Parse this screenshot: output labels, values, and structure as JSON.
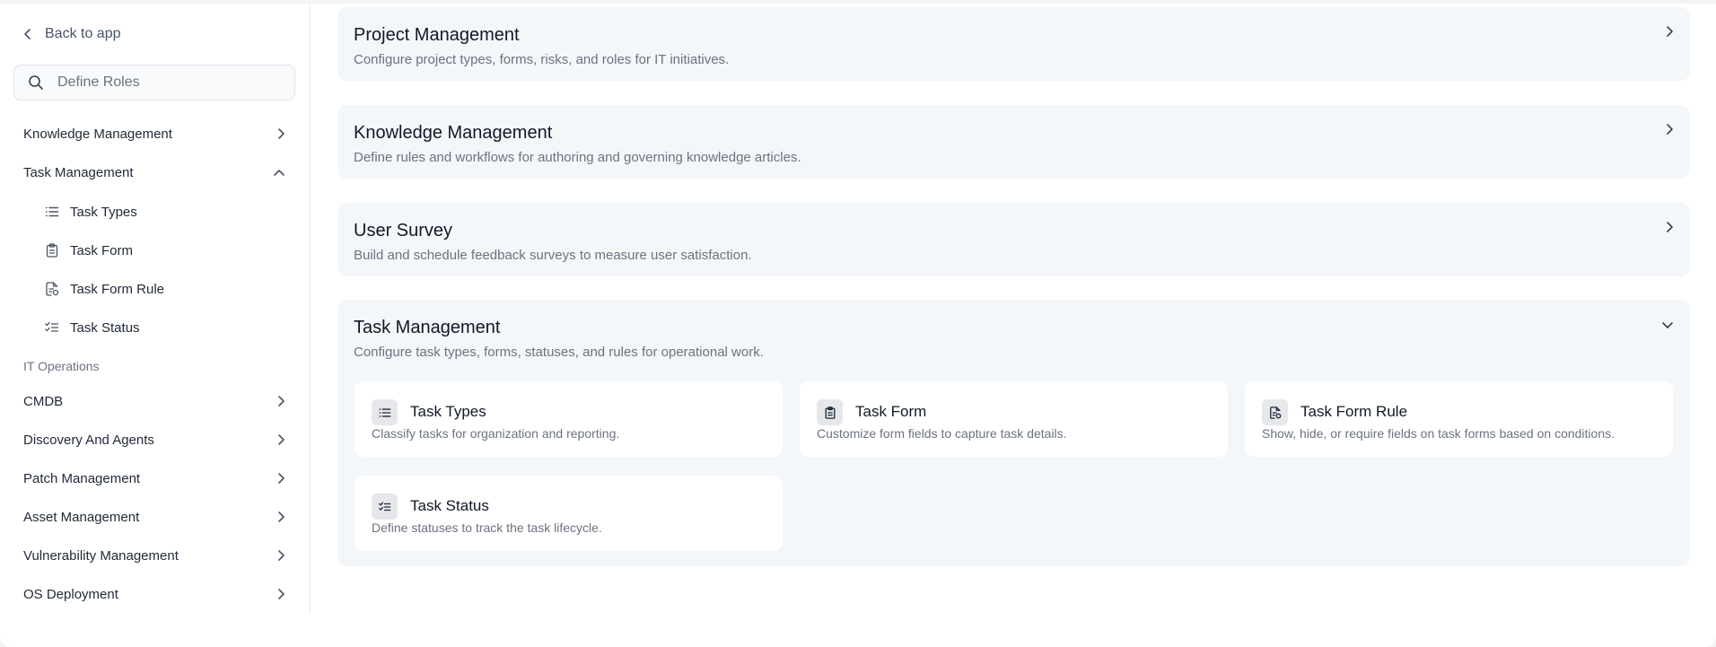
{
  "sidebar": {
    "back_label": "Back to app",
    "search_placeholder": "Define Roles",
    "items_top": [
      {
        "label": "Knowledge Management"
      },
      {
        "label": "Task Management"
      }
    ],
    "task_sub_items": [
      {
        "label": "Task Types",
        "icon": "list-icon"
      },
      {
        "label": "Task Form",
        "icon": "clipboard-icon"
      },
      {
        "label": "Task Form Rule",
        "icon": "file-rule-icon"
      },
      {
        "label": "Task Status",
        "icon": "checklist-icon"
      }
    ],
    "section_label": "IT Operations",
    "items_bottom": [
      {
        "label": "CMDB"
      },
      {
        "label": "Discovery And Agents"
      },
      {
        "label": "Patch Management"
      },
      {
        "label": "Asset Management"
      },
      {
        "label": "Vulnerability Management"
      },
      {
        "label": "OS Deployment"
      }
    ]
  },
  "main": {
    "cards": [
      {
        "title": "Project Management",
        "description": "Configure project types, forms, risks, and roles for IT initiatives."
      },
      {
        "title": "Knowledge Management",
        "description": "Define rules and workflows for authoring and governing knowledge articles."
      },
      {
        "title": "User Survey",
        "description": "Build and schedule feedback surveys to measure user satisfaction."
      },
      {
        "title": "Task Management",
        "description": "Configure task types, forms, statuses, and rules for operational work."
      }
    ],
    "task_subcards": [
      {
        "title": "Task Types",
        "description": "Classify tasks for organization and reporting.",
        "icon": "list-icon"
      },
      {
        "title": "Task Form",
        "description": "Customize form fields to capture task details.",
        "icon": "clipboard-icon"
      },
      {
        "title": "Task Form Rule",
        "description": "Show, hide, or require fields on task forms based on conditions.",
        "icon": "file-rule-icon"
      },
      {
        "title": "Task Status",
        "description": "Define statuses to track the task lifecycle.",
        "icon": "checklist-icon"
      }
    ]
  }
}
